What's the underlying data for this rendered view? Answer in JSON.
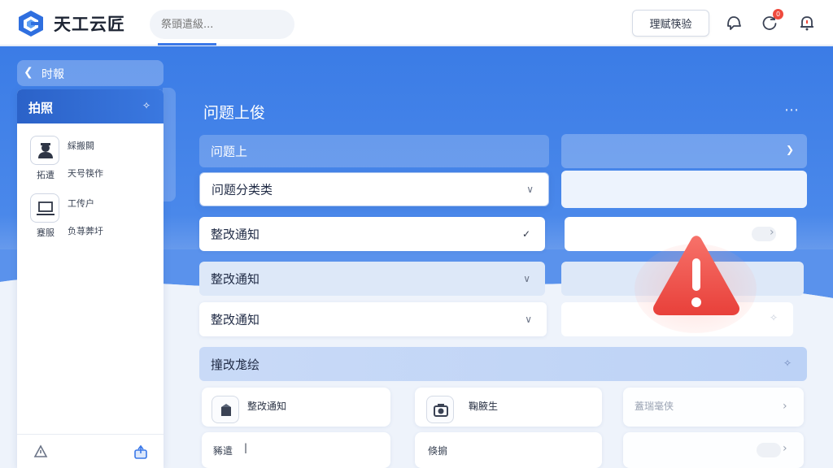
{
  "header": {
    "app_title": "天工云匠",
    "search_placeholder": "祭頭遣級...",
    "action_button": "理赋筷验",
    "notification_count": "0",
    "icons": [
      "logo-icon",
      "chat-bell-icon",
      "refresh-icon",
      "alert-bell-icon"
    ]
  },
  "sidebar": {
    "back_label": "时報",
    "header_label": "拍照",
    "items": [
      {
        "title": "綵搬闕",
        "caption": "拓遭",
        "sub": "天号筷作",
        "icon": "user-icon"
      },
      {
        "title": "工传户",
        "caption": "蹇服",
        "sub": "负荨莾圩",
        "icon": "laptop-icon"
      }
    ],
    "bottom_icons": [
      "warning-triangle-icon",
      "upload-icon"
    ]
  },
  "main": {
    "title": "问题上俊",
    "fields": [
      {
        "label": "问题上"
      },
      {
        "label": "问题分类类"
      },
      {
        "label": "整改通知"
      },
      {
        "label": "整改通知"
      },
      {
        "label": "整改通知"
      }
    ],
    "section_title": "撞改尨绘",
    "cards": [
      {
        "title": "整改通知",
        "row_text": "豨遣"
      },
      {
        "title": "鞠腋生",
        "row_text": "倏掮"
      },
      {
        "title": "蓋瑞毫侠",
        "row_text": ""
      }
    ]
  },
  "colors": {
    "brand": "#3b7ce6",
    "warning": "#ef4a3d",
    "badge": "#ef4a3d"
  }
}
